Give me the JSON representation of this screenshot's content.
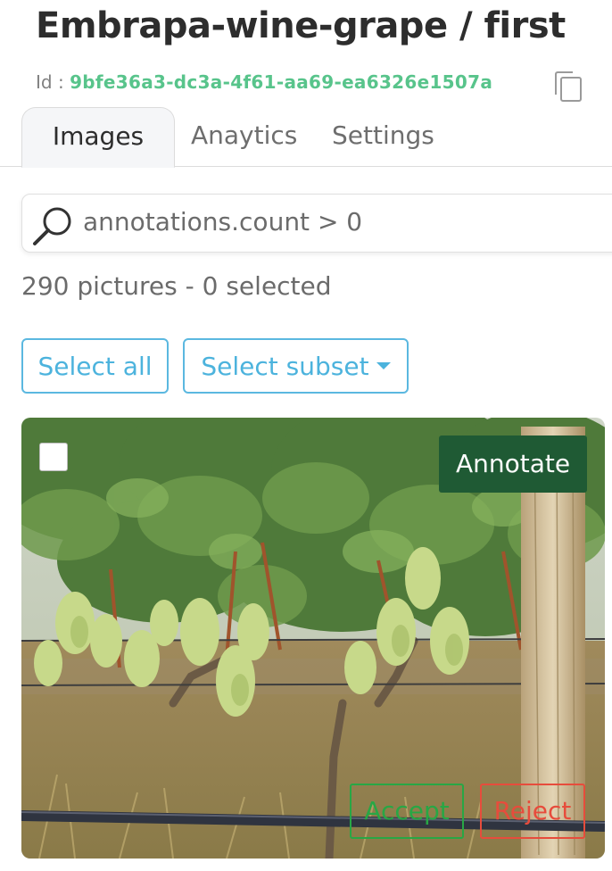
{
  "header": {
    "title": "Embrapa-wine-grape / first",
    "id_label": "Id :",
    "id_value": "9bfe36a3-dc3a-4f61-aa69-ea6326e1507a",
    "copy_icon": "copy-icon"
  },
  "tabs": [
    {
      "label": "Images",
      "active": true
    },
    {
      "label": "Anaytics",
      "active": false
    },
    {
      "label": "Settings",
      "active": false
    }
  ],
  "search": {
    "query": "annotations.count > 0",
    "icon": "search-icon"
  },
  "summary": {
    "text": "290 pictures - 0 selected"
  },
  "toolbar": {
    "select_all_label": "Select all",
    "select_subset_label": "Select subset"
  },
  "card": {
    "annotate_label": "Annotate",
    "accept_label": "Accept",
    "reject_label": "Reject",
    "checked": false
  },
  "colors": {
    "accent_blue": "#4cb3dd",
    "id_green": "#58c48b",
    "annotate_green": "#1f5a34",
    "accept_green": "#28a745",
    "reject_red": "#e74c3c"
  }
}
